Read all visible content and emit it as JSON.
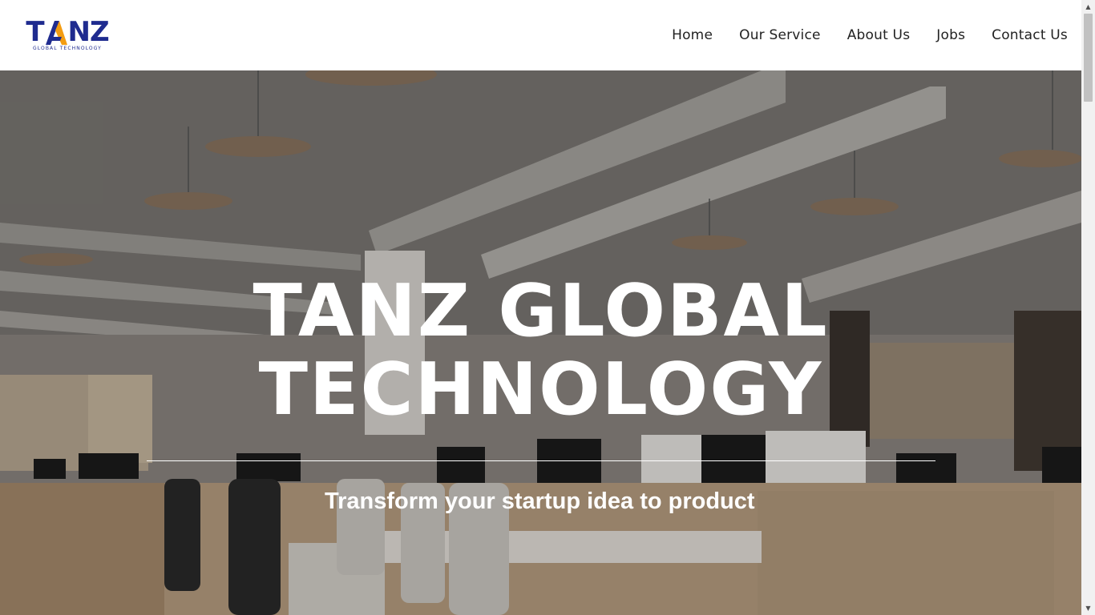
{
  "brand": {
    "logo_letters": [
      "T",
      "A",
      "N",
      "Z"
    ],
    "logo_tagline": "GLOBAL TECHNOLOGY",
    "primary_color": "#1f2b8f",
    "accent_color": "#f39c12"
  },
  "nav": {
    "items": [
      {
        "label": "Home"
      },
      {
        "label": "Our Service"
      },
      {
        "label": "About Us"
      },
      {
        "label": "Jobs"
      },
      {
        "label": "Contact Us"
      }
    ]
  },
  "hero": {
    "title_line1": "TANZ GLOBAL",
    "title_line2": "TECHNOLOGY",
    "tagline": "Transform your startup idea to product",
    "background": "office-interior-photo"
  },
  "scrollbar": {
    "up_icon": "arrow-up-icon",
    "down_icon": "arrow-down-icon"
  }
}
